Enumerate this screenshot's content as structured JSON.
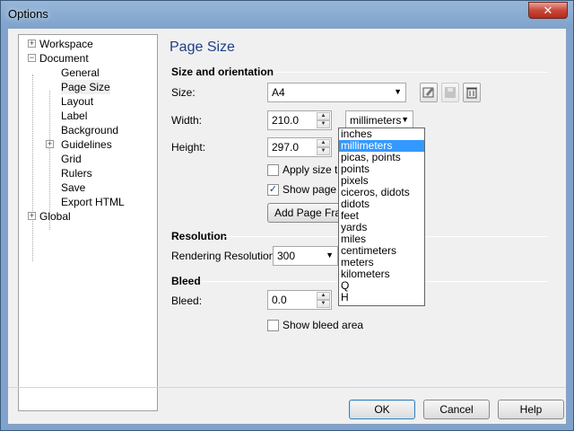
{
  "window": {
    "title": "Options",
    "close_glyph": "✕"
  },
  "tree": {
    "items": [
      {
        "label": "Workspace",
        "expander": "+"
      },
      {
        "label": "Document",
        "expander": "−"
      },
      {
        "label": "General"
      },
      {
        "label": "Page Size"
      },
      {
        "label": "Layout"
      },
      {
        "label": "Label"
      },
      {
        "label": "Background"
      },
      {
        "label": "Guidelines",
        "expander": "+"
      },
      {
        "label": "Grid"
      },
      {
        "label": "Rulers"
      },
      {
        "label": "Save"
      },
      {
        "label": "Export HTML"
      },
      {
        "label": "Global",
        "expander": "+"
      }
    ]
  },
  "panel": {
    "title": "Page Size",
    "size_orientation": {
      "heading": "Size and orientation",
      "size_label": "Size:",
      "size_value": "A4",
      "width_label": "Width:",
      "width_value": "210.0",
      "units_value": "millimeters",
      "height_label": "Height:",
      "height_value": "297.0",
      "apply_size_label": "Apply size to",
      "show_page_label": "Show page bo",
      "add_frame_label": "Add Page Fra"
    },
    "resolution": {
      "heading": "Resolution",
      "rendering_label": "Rendering Resolution:",
      "rendering_value": "300"
    },
    "bleed": {
      "heading": "Bleed",
      "bleed_label": "Bleed:",
      "bleed_value": "0.0",
      "show_bleed_label": "Show bleed area"
    },
    "units_options": [
      "inches",
      "millimeters",
      "picas, points",
      "points",
      "pixels",
      "ciceros, didots",
      "didots",
      "feet",
      "yards",
      "miles",
      "centimeters",
      "meters",
      "kilometers",
      "Q",
      "H"
    ]
  },
  "footer": {
    "ok": "OK",
    "cancel": "Cancel",
    "help": "Help"
  }
}
